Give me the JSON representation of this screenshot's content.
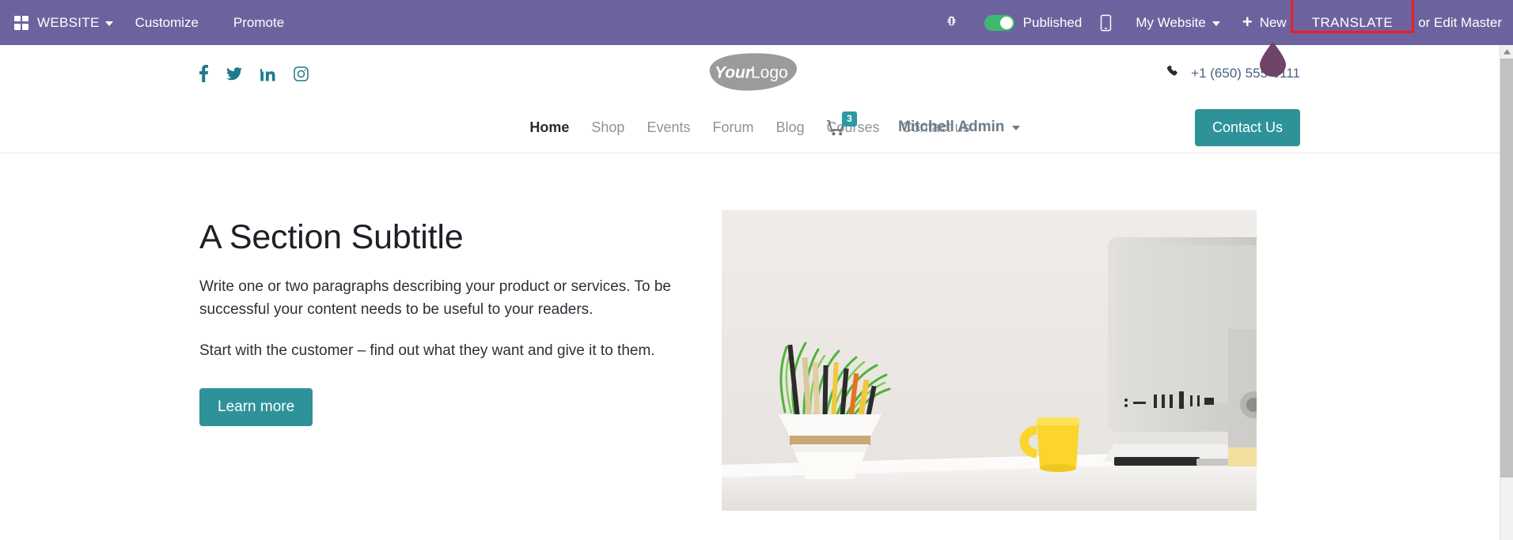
{
  "editor_bar": {
    "apps_icon": "apps-grid-icon",
    "brand": "WEBSITE",
    "menu": [
      {
        "label": "Customize",
        "name": "customize"
      },
      {
        "label": "Promote",
        "name": "promote"
      }
    ],
    "bug_icon": "bug-icon",
    "publish_toggle": {
      "label": "Published",
      "state": "on",
      "color": "#3DBA70"
    },
    "mobile_preview_icon": "mobile-preview-icon",
    "site_selector": "My Website",
    "new_label": "New",
    "translate_label": "TRANSLATE",
    "edit_master_label": "or Edit Master",
    "highlight_color": "#EE1D24",
    "bar_color": "#6C639E"
  },
  "site_header": {
    "social": [
      {
        "name": "facebook-icon",
        "label": "Facebook"
      },
      {
        "name": "twitter-icon",
        "label": "Twitter"
      },
      {
        "name": "linkedin-icon",
        "label": "LinkedIn"
      },
      {
        "name": "instagram-icon",
        "label": "Instagram"
      }
    ],
    "logo": {
      "text_bold": "Your",
      "text_light": "Logo"
    },
    "phone": "+1 (650) 555-0111",
    "phone_icon": "phone-icon"
  },
  "site_nav": {
    "links": [
      {
        "label": "Home",
        "active": true
      },
      {
        "label": "Shop",
        "active": false
      },
      {
        "label": "Events",
        "active": false
      },
      {
        "label": "Forum",
        "active": false
      },
      {
        "label": "Blog",
        "active": false
      },
      {
        "label": "Courses",
        "active": false
      },
      {
        "label": "Contact us",
        "active": false
      }
    ],
    "cart": {
      "icon": "shopping-cart-icon",
      "count": "3",
      "badge_color": "#2E98A6"
    },
    "user": "Mitchell Admin",
    "cta_label": "Contact Us",
    "cta_color": "#2E9399"
  },
  "hero": {
    "title": "A Section Subtitle",
    "paragraph1": "Write one or two paragraphs describing your product or services. To be successful your content needs to be useful to your readers.",
    "paragraph2": "Start with the customer – find out what they want and give it to them.",
    "button_label": "Learn more",
    "image_alt": "Desk with plant pot of pencils, yellow mug and iMac monitor"
  },
  "cursor": {
    "name": "drop-cursor-marker",
    "color": "#6E4469"
  }
}
